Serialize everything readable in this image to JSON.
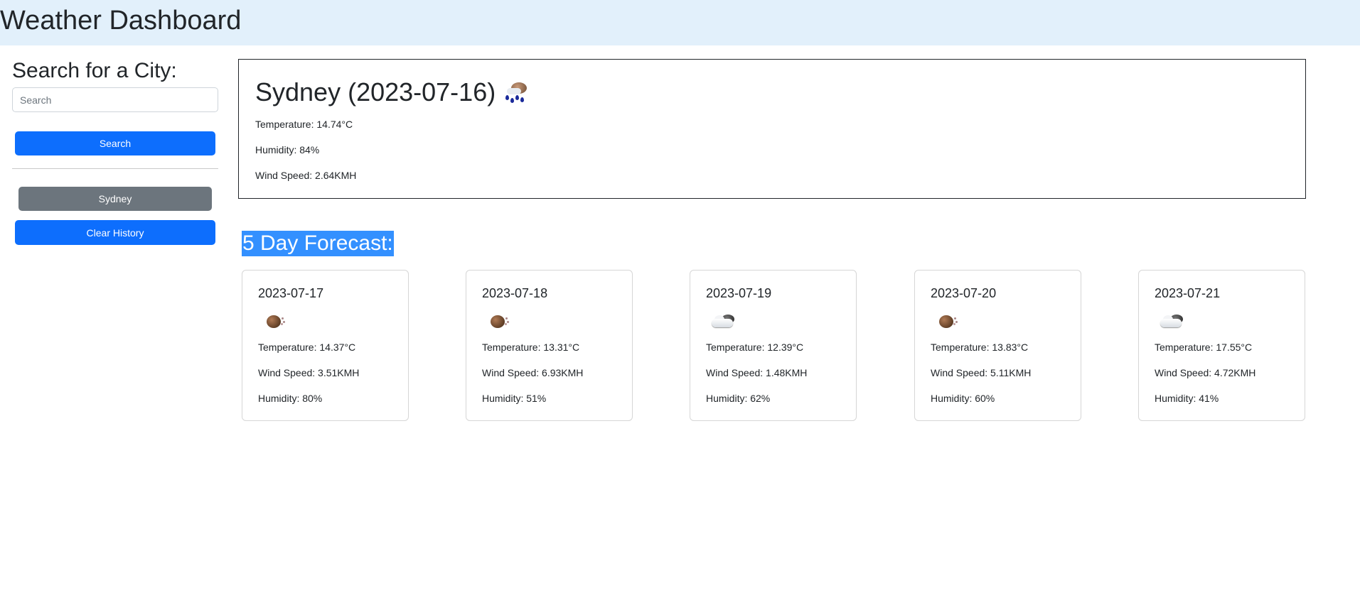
{
  "header": {
    "title": "Weather Dashboard"
  },
  "sidebar": {
    "heading": "Search for a City:",
    "search_placeholder": "Search",
    "search_button": "Search",
    "history": [
      "Sydney"
    ],
    "clear_button": "Clear History"
  },
  "current": {
    "title": "Sydney (2023-07-16)",
    "icon": "rain-cloud-icon",
    "temperature": "Temperature: 14.74°C",
    "humidity": "Humidity: 84%",
    "wind": "Wind Speed: 2.64KMH"
  },
  "forecast": {
    "title": "5 Day Forecast:",
    "days": [
      {
        "date": "2023-07-17",
        "icon": "moon-icon",
        "temperature": "Temperature: 14.37°C",
        "wind": "Wind Speed: 3.51KMH",
        "humidity": "Humidity: 80%"
      },
      {
        "date": "2023-07-18",
        "icon": "moon-icon",
        "temperature": "Temperature: 13.31°C",
        "wind": "Wind Speed: 6.93KMH",
        "humidity": "Humidity: 51%"
      },
      {
        "date": "2023-07-19",
        "icon": "cloud-icon",
        "temperature": "Temperature: 12.39°C",
        "wind": "Wind Speed: 1.48KMH",
        "humidity": "Humidity: 62%"
      },
      {
        "date": "2023-07-20",
        "icon": "moon-icon",
        "temperature": "Temperature: 13.83°C",
        "wind": "Wind Speed: 5.11KMH",
        "humidity": "Humidity: 60%"
      },
      {
        "date": "2023-07-21",
        "icon": "cloud-icon",
        "temperature": "Temperature: 17.55°C",
        "wind": "Wind Speed: 4.72KMH",
        "humidity": "Humidity: 41%"
      }
    ]
  },
  "colors": {
    "header_bg": "#e2f0fb",
    "primary": "#0d6efd",
    "secondary": "#6c757d",
    "selection": "#3390ff"
  }
}
